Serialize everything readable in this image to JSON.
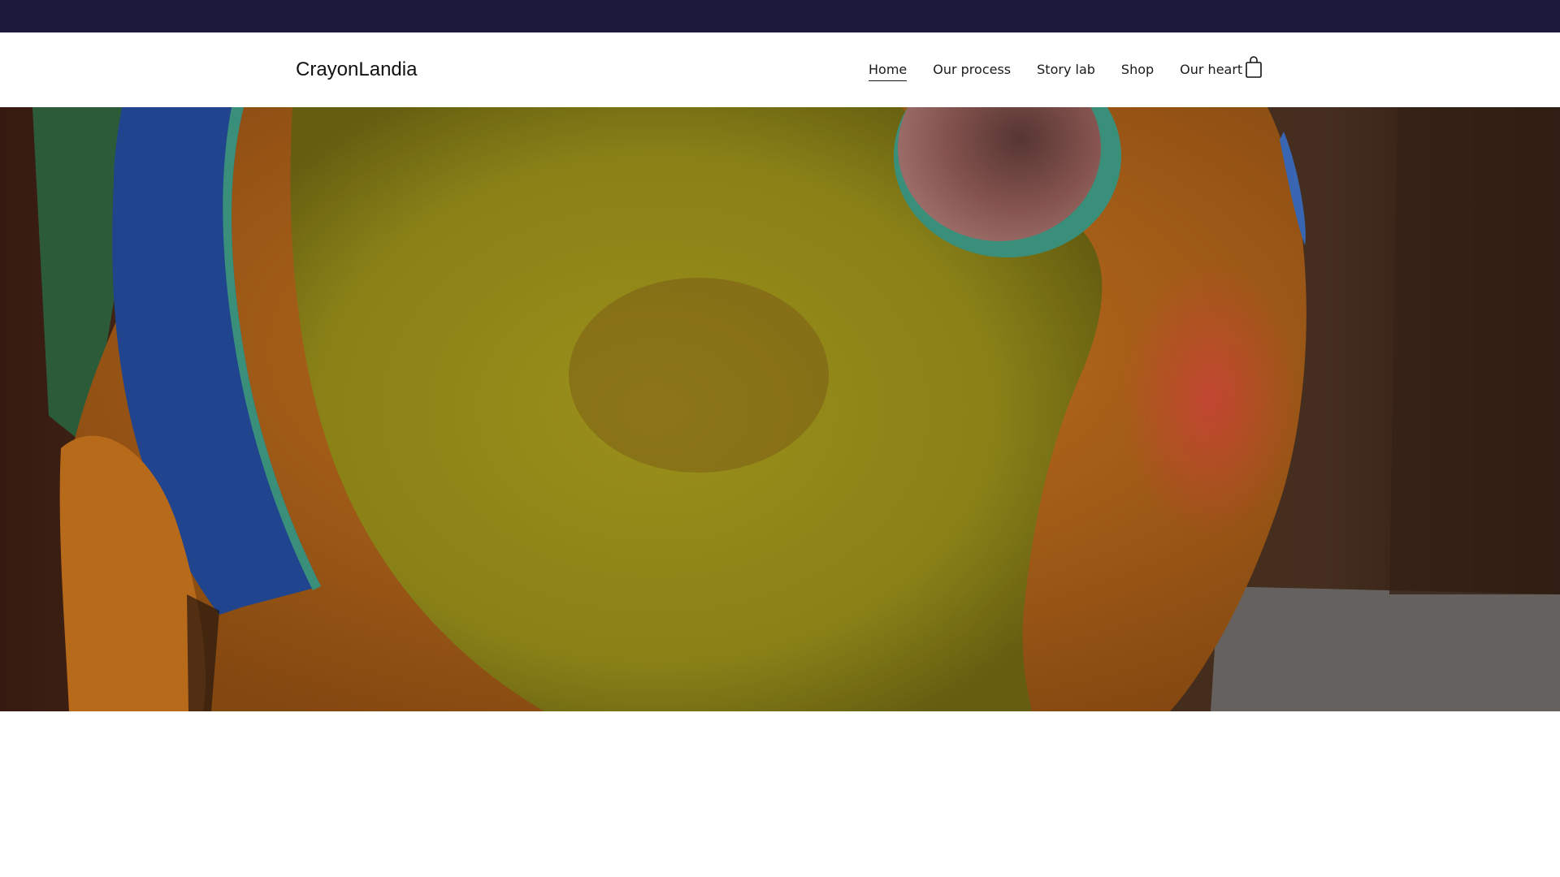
{
  "announcement_bar": {
    "color": "#1b1a3a"
  },
  "header": {
    "logo": "CrayonLandia",
    "nav": [
      {
        "label": "Home",
        "active": true
      },
      {
        "label": "Our process",
        "active": false
      },
      {
        "label": "Story lab",
        "active": false
      },
      {
        "label": "Shop",
        "active": false
      },
      {
        "label": "Our heart",
        "active": false
      }
    ],
    "cart_icon": "shopping-bag-icon"
  },
  "hero": {
    "image": "painted-sculpture-closeup",
    "colors": {
      "yellow": "#a39a1c",
      "orange": "#c8741e",
      "blue": "#234a9a",
      "teal": "#3f9c86",
      "pink": "#8f5a55",
      "background": "#3a2414"
    }
  }
}
